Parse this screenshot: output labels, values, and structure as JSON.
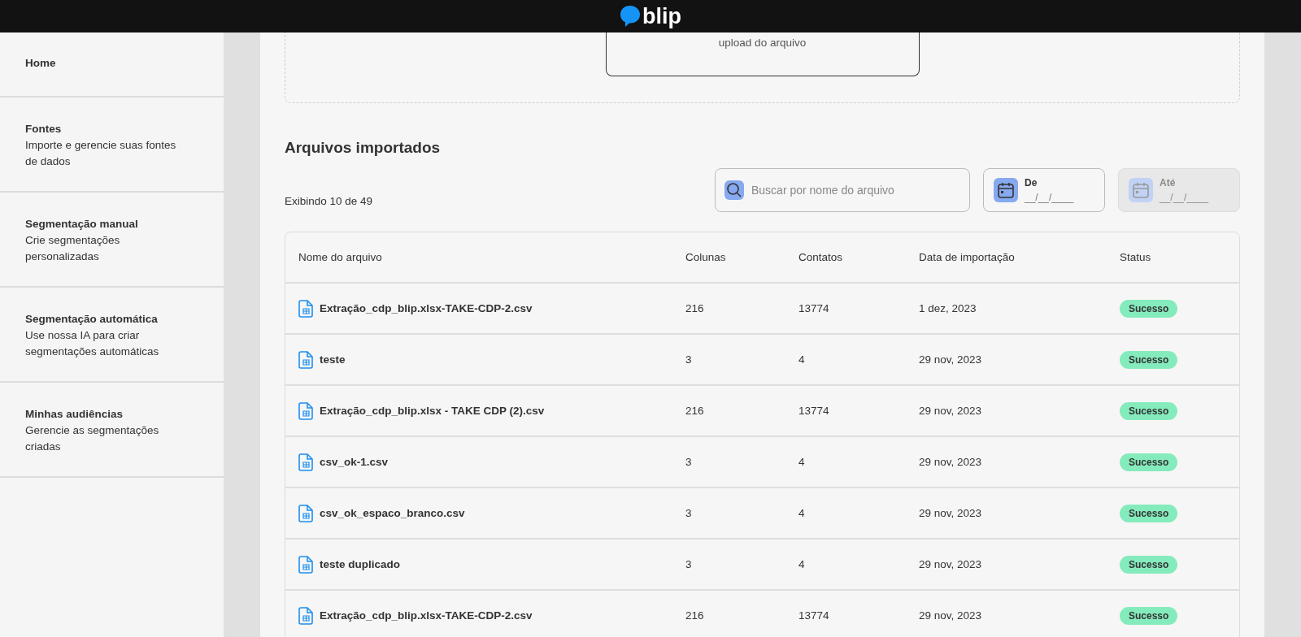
{
  "header": {
    "logo_text": "blip"
  },
  "sidebar": {
    "items": [
      {
        "title": "Home"
      },
      {
        "title": "Fontes",
        "description": "Importe e gerencie suas fontes de dados"
      },
      {
        "title": "Segmentação manual",
        "description": "Crie segmentações personalizadas"
      },
      {
        "title": "Segmentação automática",
        "description": "Use nossa IA para criar segmentações automáticas"
      },
      {
        "title": "Minhas audiências",
        "description": "Gerencie as segmentações criadas"
      }
    ]
  },
  "upload": {
    "button_text": "upload do arquivo"
  },
  "imported_files": {
    "title": "Arquivos importados",
    "count_text": "Exibindo 10 de 49",
    "search": {
      "placeholder": "Buscar por nome do arquivo"
    },
    "date_filters": [
      {
        "label": "De",
        "placeholder": "__/__/____",
        "disabled": false
      },
      {
        "label": "Até",
        "placeholder": "__/__/____",
        "disabled": true
      }
    ],
    "table": {
      "columns": [
        "Nome do arquivo",
        "Colunas",
        "Contatos",
        "Data de importação",
        "Status"
      ],
      "rows": [
        {
          "name": "Extração_cdp_blip.xlsx-TAKE-CDP-2.csv",
          "columns": "216",
          "contacts": "13774",
          "date": "1 dez, 2023",
          "status": "Sucesso",
          "kind": "success"
        },
        {
          "name": "teste",
          "columns": "3",
          "contacts": "4",
          "date": "29 nov, 2023",
          "status": "Sucesso",
          "kind": "success"
        },
        {
          "name": "Extração_cdp_blip.xlsx - TAKE CDP (2).csv",
          "columns": "216",
          "contacts": "13774",
          "date": "29 nov, 2023",
          "status": "Sucesso",
          "kind": "success"
        },
        {
          "name": "csv_ok-1.csv",
          "columns": "3",
          "contacts": "4",
          "date": "29 nov, 2023",
          "status": "Sucesso",
          "kind": "success"
        },
        {
          "name": "csv_ok_espaco_branco.csv",
          "columns": "3",
          "contacts": "4",
          "date": "29 nov, 2023",
          "status": "Sucesso",
          "kind": "success"
        },
        {
          "name": "teste duplicado",
          "columns": "3",
          "contacts": "4",
          "date": "29 nov, 2023",
          "status": "Sucesso",
          "kind": "success"
        },
        {
          "name": "Extração_cdp_blip.xlsx-TAKE-CDP-2.csv",
          "columns": "216",
          "contacts": "13774",
          "date": "29 nov, 2023",
          "status": "Sucesso",
          "kind": "success"
        }
      ]
    }
  }
}
